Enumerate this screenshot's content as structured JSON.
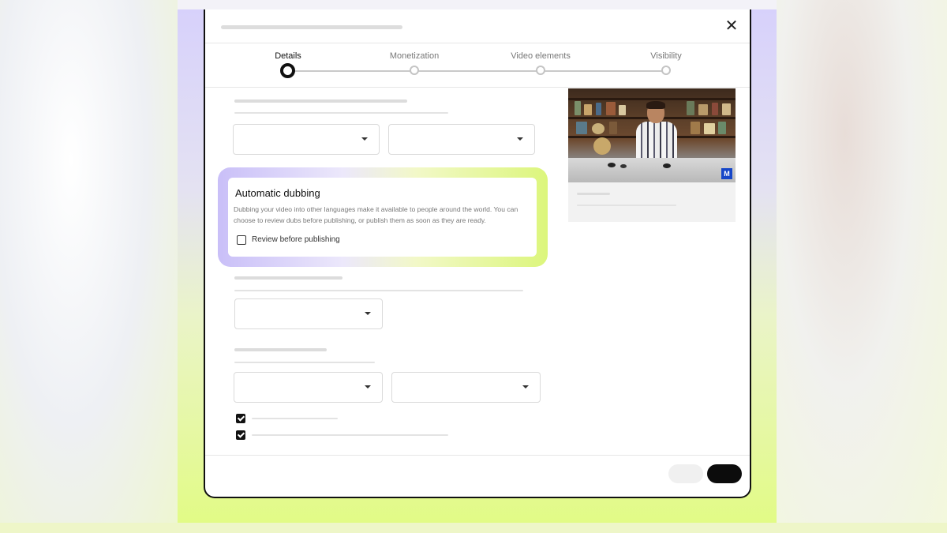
{
  "stepper": {
    "steps": [
      {
        "label": "Details",
        "active": true
      },
      {
        "label": "Monetization",
        "active": false
      },
      {
        "label": "Video elements",
        "active": false
      },
      {
        "label": "Visibility",
        "active": false
      }
    ]
  },
  "dialog": {
    "close_icon": "close-icon",
    "close_glyph": "✕"
  },
  "dubbing": {
    "title": "Automatic dubbing",
    "description": "Dubbing your video into other languages make it available to people around the world. You can choose to review dubs before publishing, or publish them as soon as they are ready.",
    "checkbox_label": "Review before publishing",
    "checkbox_checked": false
  },
  "thumbnail": {
    "badge": "M"
  },
  "colors": {
    "accent_purple": "#c9bff8",
    "accent_lime": "#dcf67c",
    "primary_button": "#0c0c0c",
    "badge_blue": "#1646c8"
  }
}
